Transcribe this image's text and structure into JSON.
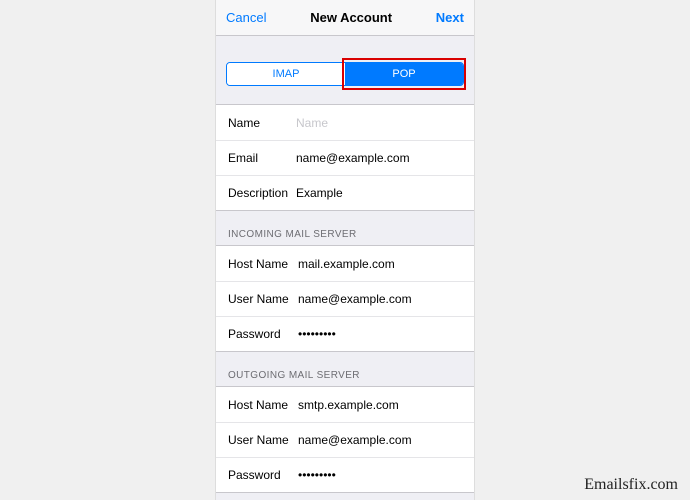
{
  "nav": {
    "cancel": "Cancel",
    "title": "New Account",
    "next": "Next"
  },
  "tabs": {
    "imap": "IMAP",
    "pop": "POP"
  },
  "account": {
    "name_label": "Name",
    "name_value": "Name",
    "email_label": "Email",
    "email_value": "name@example.com",
    "desc_label": "Description",
    "desc_value": "Example"
  },
  "incoming": {
    "header": "Incoming Mail Server",
    "host_label": "Host Name",
    "host_value": "mail.example.com",
    "user_label": "User Name",
    "user_value": "name@example.com",
    "pass_label": "Password",
    "pass_value": "•••••••••"
  },
  "outgoing": {
    "header": "Outgoing Mail Server",
    "host_label": "Host Name",
    "host_value": "smtp.example.com",
    "user_label": "User Name",
    "user_value": "name@example.com",
    "pass_label": "Password",
    "pass_value": "•••••••••"
  },
  "watermark": "Emailsfix.com"
}
